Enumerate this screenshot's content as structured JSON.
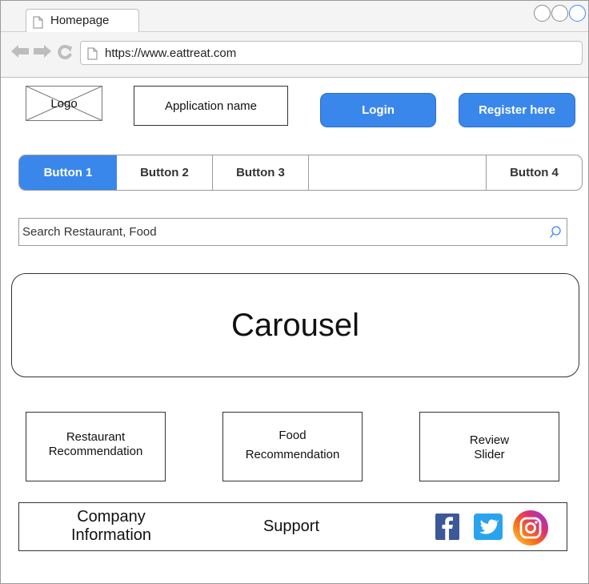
{
  "browser": {
    "tab_title": "Homepage",
    "url": "https://www.eattreat.com"
  },
  "header": {
    "logo_label": "Logo",
    "app_name": "Application name",
    "login_label": "Login",
    "register_label": "Register here"
  },
  "nav_buttons": [
    "Button 1",
    "Button 2",
    "Button 3",
    "Button 4"
  ],
  "search": {
    "placeholder": "Search Restaurant, Food"
  },
  "carousel": {
    "label": "Carousel"
  },
  "cards": {
    "restaurant": [
      "Restaurant",
      "Recommendation"
    ],
    "food": [
      "Food",
      "Recommendation"
    ],
    "review": [
      "Review",
      "Slider"
    ]
  },
  "footer": {
    "company": [
      "Company",
      "Information"
    ],
    "support": "Support",
    "social": [
      "facebook-icon",
      "twitter-icon",
      "instagram-icon"
    ]
  },
  "colors": {
    "accent": "#3a87ec",
    "facebook": "#3b5998",
    "twitter": "#2aa3ef"
  }
}
